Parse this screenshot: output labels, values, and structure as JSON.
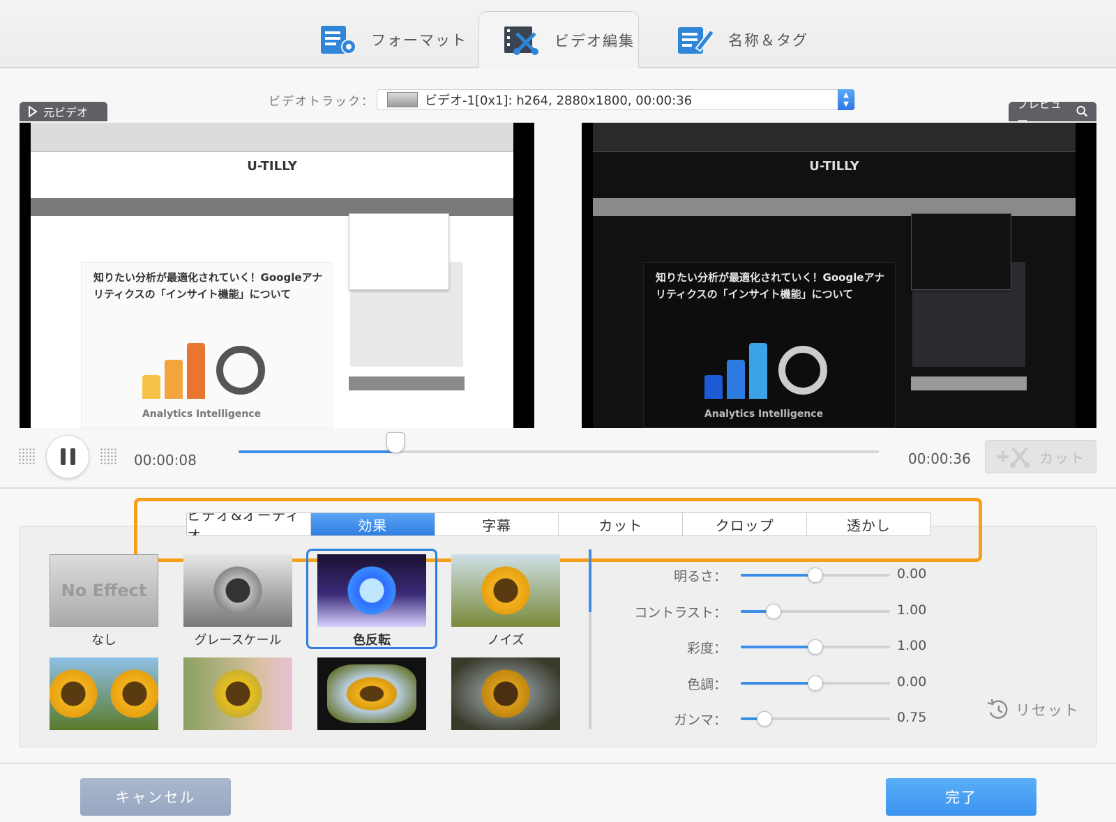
{
  "top_tabs": [
    {
      "label": "フォーマット",
      "active": false,
      "icon": "format-settings-icon"
    },
    {
      "label": "ビデオ編集",
      "active": true,
      "icon": "video-edit-scissors-icon"
    },
    {
      "label": "名称＆タグ",
      "active": false,
      "icon": "name-tag-edit-icon"
    }
  ],
  "video_track": {
    "label": "ビデオトラック：",
    "value": "ビデオ-1[0x1]: h264, 2880x1800, 00:00:36"
  },
  "source_panel": {
    "label": "元ビデオ",
    "icon": "play-icon"
  },
  "preview_panel": {
    "label": "プレビュー",
    "icon": "search-icon"
  },
  "video_content": {
    "site_logo": "U-TILLY",
    "article_title": "知りたい分析が最適化されていく！Googleアナリティクスの「インサイト機能」について",
    "graphic_caption": "Analytics Intelligence"
  },
  "playback": {
    "current_time": "00:00:08",
    "total_time": "00:00:36",
    "progress": 0.245,
    "cut_label": "カット"
  },
  "sub_tabs": [
    {
      "label": "ビデオ&オーディオ",
      "active": false
    },
    {
      "label": "効果",
      "active": true
    },
    {
      "label": "字幕",
      "active": false
    },
    {
      "label": "カット",
      "active": false
    },
    {
      "label": "クロップ",
      "active": false
    },
    {
      "label": "透かし",
      "active": false
    }
  ],
  "effects": [
    {
      "label": "なし",
      "thumb_text": "No Effect",
      "selected": false
    },
    {
      "label": "グレースケール",
      "selected": false
    },
    {
      "label": "色反転",
      "selected": true
    },
    {
      "label": "ノイズ",
      "selected": false
    },
    {
      "label": "",
      "selected": false
    },
    {
      "label": "",
      "selected": false
    },
    {
      "label": "",
      "selected": false
    },
    {
      "label": "",
      "selected": false
    }
  ],
  "adjustments": [
    {
      "label": "明るさ：",
      "value": "0.00",
      "level": 0.5
    },
    {
      "label": "コントラスト：",
      "value": "1.00",
      "level": 0.22
    },
    {
      "label": "彩度：",
      "value": "1.00",
      "level": 0.5
    },
    {
      "label": "色調：",
      "value": "0.00",
      "level": 0.5
    },
    {
      "label": "ガンマ：",
      "value": "0.75",
      "level": 0.16
    }
  ],
  "reset_label": "リセット",
  "buttons": {
    "cancel": "キャンセル",
    "done": "完了"
  },
  "colors": {
    "accent": "#2f7de0",
    "highlight": "#f6a01a"
  }
}
